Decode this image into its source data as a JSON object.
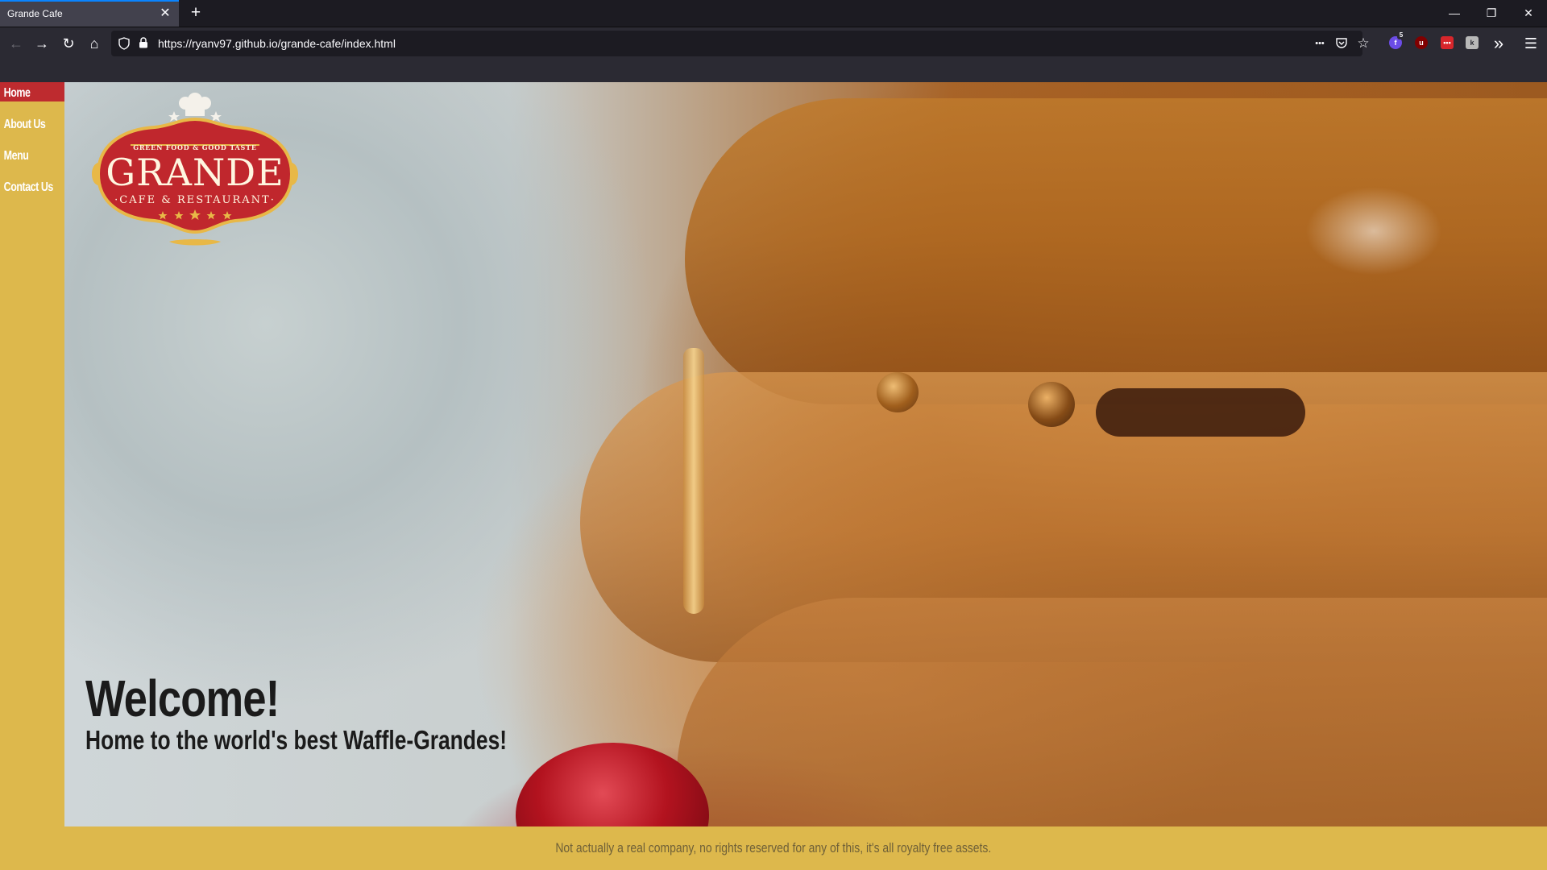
{
  "browser": {
    "tab": {
      "title": "Grande Cafe",
      "close_glyph": "✕"
    },
    "new_tab_glyph": "+",
    "window_controls": {
      "minimize": "—",
      "restore": "❐",
      "close": "✕"
    },
    "nav": {
      "back_glyph": "←",
      "forward_glyph": "→",
      "reload_glyph": "↻",
      "home_glyph": "⌂"
    },
    "url": "https://ryanv97.github.io/grande-cafe/index.html",
    "url_actions": {
      "more_glyph": "•••",
      "pocket_glyph": "⛉",
      "bookmark_glyph": "☆"
    },
    "extensions": {
      "badge_count": "5",
      "overflow_glyph": "»",
      "menu_glyph": "☰"
    }
  },
  "site": {
    "nav": {
      "items": [
        {
          "label": "Home",
          "active": true
        },
        {
          "label": "About Us",
          "active": false
        },
        {
          "label": "Menu",
          "active": false
        },
        {
          "label": "Contact Us",
          "active": false
        }
      ]
    },
    "logo": {
      "tagline": "GREEN FOOD & GOOD TASTE",
      "name": "GRANDE",
      "subtitle": "·CAFE & RESTAURANT·",
      "colors": {
        "badge": "#c0272d",
        "trim": "#e8b847",
        "text": "#fff6e0"
      }
    },
    "hero": {
      "title": "Welcome!",
      "subtitle": "Home to the world's best Waffle-Grandes!"
    },
    "footer": {
      "text": "Not actually a real company, no rights reserved for any of this, it's all royalty free assets."
    },
    "colors": {
      "accent_yellow": "#ddb84c",
      "active_red": "#be2b2f"
    }
  }
}
